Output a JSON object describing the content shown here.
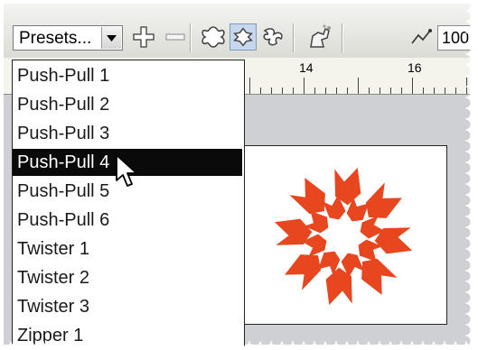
{
  "toolbar": {
    "presets_label": "Presets...",
    "zoom_value": "100",
    "icons": [
      "dropdown-arrow-icon",
      "add-node-icon",
      "remove-node-icon",
      "flower-shape-icon",
      "pinwheel-shape-icon",
      "twist-shape-icon",
      "puppet-icon",
      "node-curve-icon"
    ]
  },
  "ruler": {
    "labels": [
      "14",
      "16"
    ]
  },
  "preset_menu": {
    "items": [
      "Push-Pull 1",
      "Push-Pull 2",
      "Push-Pull 3",
      "Push-Pull 4",
      "Push-Pull 5",
      "Push-Pull 6",
      "Twister 1",
      "Twister 2",
      "Twister 3",
      "Zipper 1"
    ],
    "selected_index": 3
  },
  "colors": {
    "shape_fill": "#e8461e",
    "selection_bg": "#0a0a0a",
    "toolbar_bg": "#e4e4df"
  }
}
